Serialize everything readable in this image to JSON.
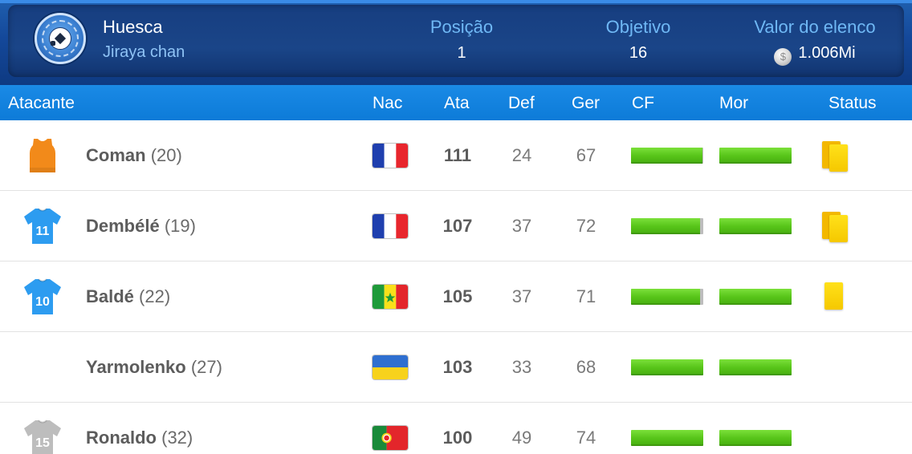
{
  "header": {
    "club": "Huesca",
    "manager": "Jiraya chan",
    "position_label": "Posição",
    "position_value": "1",
    "objective_label": "Objetivo",
    "objective_value": "16",
    "squad_value_label": "Valor do elenco",
    "squad_value": "1.006Mi",
    "coin_glyph": "$"
  },
  "columns": {
    "position": "Atacante",
    "nac": "Nac",
    "ata": "Ata",
    "def": "Def",
    "ger": "Ger",
    "cf": "CF",
    "mor": "Mor",
    "status": "Status"
  },
  "players": [
    {
      "name": "Coman",
      "age": "(20)",
      "ata": "111",
      "def": "24",
      "ger": "67",
      "shirt": "bib",
      "shirt_color": "#f28a1a",
      "number": "",
      "flag": "France",
      "cf": 0.99,
      "mor": 1.0,
      "status": "two-yellow-cards"
    },
    {
      "name": "Dembélé",
      "age": "(19)",
      "ata": "107",
      "def": "37",
      "ger": "72",
      "shirt": "jersey",
      "shirt_color": "#2d9cf0",
      "number": "11",
      "flag": "France",
      "cf": 0.96,
      "mor": 1.0,
      "status": "two-yellow-cards"
    },
    {
      "name": "Baldé",
      "age": "(22)",
      "ata": "105",
      "def": "37",
      "ger": "71",
      "shirt": "jersey",
      "shirt_color": "#2d9cf0",
      "number": "10",
      "flag": "Senegal",
      "cf": 0.96,
      "mor": 1.0,
      "status": "yellow-card"
    },
    {
      "name": "Yarmolenko",
      "age": "(27)",
      "ata": "103",
      "def": "33",
      "ger": "68",
      "shirt": "none",
      "shirt_color": "",
      "number": "",
      "flag": "Ukraine",
      "cf": 1.0,
      "mor": 1.0,
      "status": "none"
    },
    {
      "name": "Ronaldo",
      "age": "(32)",
      "ata": "100",
      "def": "49",
      "ger": "74",
      "shirt": "jersey",
      "shirt_color": "#bdbdbd",
      "number": "15",
      "flag": "Portugal",
      "cf": 1.0,
      "mor": 1.0,
      "status": "none"
    }
  ]
}
